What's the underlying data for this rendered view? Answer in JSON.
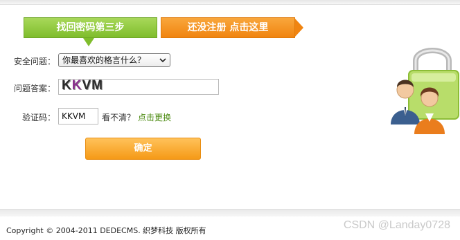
{
  "steps": {
    "current": "找回密码第三步",
    "register_link": "还没注册 点击这里"
  },
  "form": {
    "security_question_label": "安全问题：",
    "security_question_value": "你最喜欢的格言什么？",
    "answer_label": "问题答案：",
    "captcha_label": "验证码：",
    "captcha_input_value": "KKVM",
    "captcha_image_text": "KKVM",
    "unclear_text": "看不清？",
    "change_link": "点击更换",
    "confirm_button": "确定"
  },
  "footer": {
    "copyright": "Copyright © 2004-2011 DEDECMS. 织梦科技 版权所有"
  },
  "watermark": "CSDN @Landay0728",
  "colors": {
    "green_tab": "#7fbd2c",
    "orange_tab": "#f08410",
    "confirm_button": "#f59a17",
    "link_green": "#4b8a10"
  }
}
